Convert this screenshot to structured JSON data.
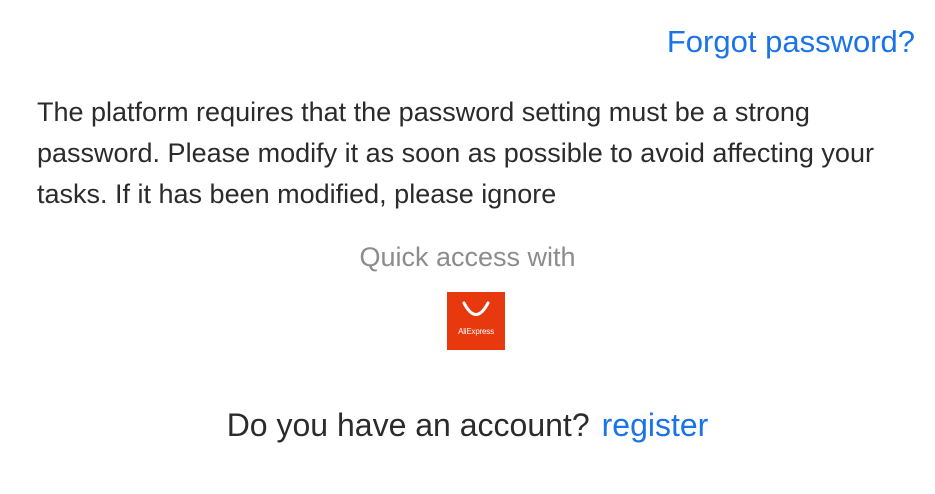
{
  "links": {
    "forgot_password": "Forgot password?",
    "register": "register"
  },
  "notice": {
    "text": "The platform requires that the password setting must be a strong password. Please modify it as soon as possible to avoid affecting your tasks. If it has been modified, please ignore"
  },
  "quick_access": {
    "label": "Quick access with",
    "providers": [
      {
        "name": "AliExpress",
        "icon": "aliexpress-logo-icon",
        "color": "#e8380d"
      }
    ]
  },
  "account": {
    "prompt": "Do you have an account?"
  },
  "colors": {
    "link": "#1a73e8",
    "text": "#2b2b2b",
    "muted": "#8c8c8c"
  }
}
